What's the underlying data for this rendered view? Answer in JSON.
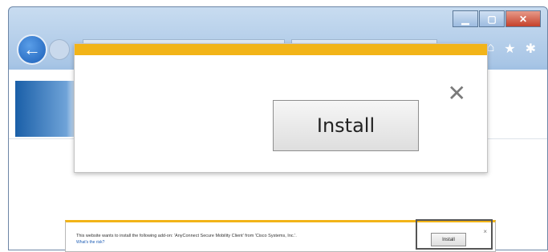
{
  "window": {
    "controls": {
      "minimize": "▁",
      "maximize": "▢",
      "close": "✕"
    },
    "back_icon": "←",
    "toolbar_icons": {
      "home": "⌂",
      "favorites": "★",
      "settings": "✱"
    }
  },
  "notification": {
    "install_label": "Install",
    "close_glyph": "✕",
    "accent_color": "#f2b418"
  },
  "mini_notification": {
    "message": "This website wants to install the following add-on: 'AnyConnect Secure Mobility Client' from 'Cisco Systems, Inc.'.",
    "link": "What's the risk?",
    "install_label": "Install",
    "close_glyph": "×"
  }
}
